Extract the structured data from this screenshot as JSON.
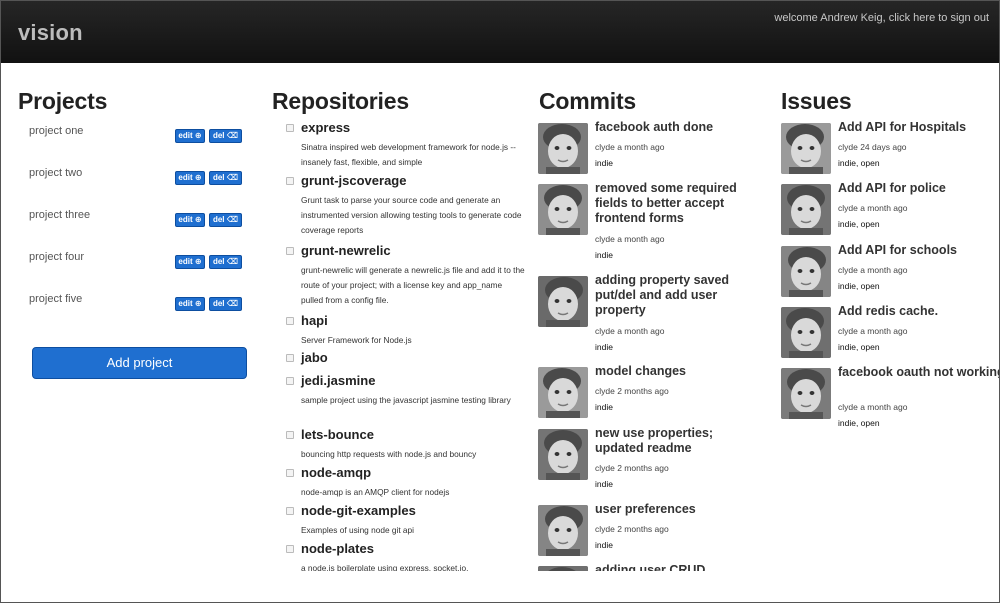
{
  "header": {
    "brand": "vision",
    "welcome": "welcome Andrew Keig, click here to sign out"
  },
  "projects": {
    "title": "Projects",
    "edit_label": "edit ⊕",
    "del_label": "del ⌫",
    "items": [
      {
        "name": "project one"
      },
      {
        "name": "project two"
      },
      {
        "name": "project three"
      },
      {
        "name": "project four"
      },
      {
        "name": "project five"
      }
    ],
    "add_label": "Add project"
  },
  "repositories": {
    "title": "Repositories",
    "items": [
      {
        "name": "express",
        "description": "Sinatra inspired web development framework for node.js -- insanely fast, flexible, and simple"
      },
      {
        "name": "grunt-jscoverage",
        "description": "Grunt task to parse your source code and generate an instrumented version allowing testing tools to generate code coverage reports"
      },
      {
        "name": "grunt-newrelic",
        "description": "grunt-newrelic will generate a newrelic.js file and add it to the route of your project; with a license key and app_name pulled from a config file."
      },
      {
        "name": "hapi",
        "description": "Server Framework for Node.js"
      },
      {
        "name": "jabo",
        "description": ""
      },
      {
        "name": "jedi.jasmine",
        "description": "sample project using the javascript jasmine testing library"
      },
      {
        "name": "lets-bounce",
        "description": "bouncing http requests with node.js and bouncy"
      },
      {
        "name": "node-amqp",
        "description": "node-amqp is an AMQP client for nodejs"
      },
      {
        "name": "node-git-examples",
        "description": "Examples of using node git api"
      },
      {
        "name": "node-plates",
        "description": "a node.js boilerplate using express, socket.io,"
      }
    ]
  },
  "commits": {
    "title": "Commits",
    "items": [
      {
        "title": "facebook auth done",
        "meta": "clyde a month ago",
        "tags": "indie",
        "avatar": "child-photo"
      },
      {
        "title": "removed some required fields to better accept frontend forms",
        "meta": "clyde a month ago",
        "tags": "indie",
        "avatar": "child-photo"
      },
      {
        "title": "adding property saved put/del and add user property",
        "meta": "clyde a month ago",
        "tags": "indie",
        "avatar": "child-photo"
      },
      {
        "title": "model changes",
        "meta": "clyde 2 months ago",
        "tags": "indie",
        "avatar": "child-photo"
      },
      {
        "title": "new use properties; updated readme",
        "meta": "clyde 2 months ago",
        "tags": "indie",
        "avatar": "child-photo"
      },
      {
        "title": "user preferences",
        "meta": "clyde 2 months ago",
        "tags": "indie",
        "avatar": "child-photo"
      },
      {
        "title": "adding user CRUD",
        "meta": "",
        "tags": "",
        "avatar": "child-photo"
      }
    ]
  },
  "issues": {
    "title": "Issues",
    "items": [
      {
        "title": "Add API for Hospitals",
        "meta": "clyde 24 days ago",
        "tags": "indie, open",
        "avatar": "child-photo"
      },
      {
        "title": "Add API for police",
        "meta": "clyde a month ago",
        "tags": "indie, open",
        "avatar": "child-photo"
      },
      {
        "title": "Add API for schools",
        "meta": "clyde a month ago",
        "tags": "indie, open",
        "avatar": "child-photo"
      },
      {
        "title": "Add redis cache.",
        "meta": "clyde a month ago",
        "tags": "indie, open",
        "avatar": "child-photo"
      },
      {
        "title": "facebook oauth not working",
        "meta": "clyde a month ago",
        "tags": "indie, open",
        "avatar": "child-photo"
      }
    ]
  },
  "colors": {
    "topbar": "#1a1a1a",
    "brand": "#bdbdbd",
    "button": "#1f6fd0"
  }
}
